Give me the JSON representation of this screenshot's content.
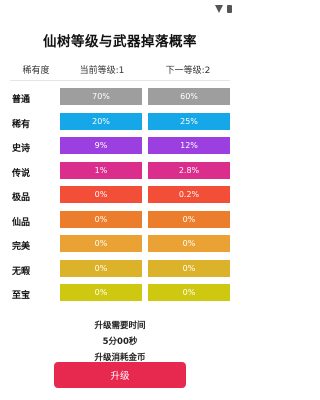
{
  "status_bar": {
    "time": "",
    "icons": [
      "wifi-icon",
      "battery-icon"
    ]
  },
  "title": "仙树等级与武器掉落概率",
  "table": {
    "headers": [
      "稀有度",
      "当前等级:1",
      "下一等级:2"
    ],
    "rows": [
      {
        "name": "普通",
        "current": "70%",
        "next": "60%",
        "color": "#9e9e9e"
      },
      {
        "name": "稀有",
        "current": "20%",
        "next": "25%",
        "color": "#16a7e8"
      },
      {
        "name": "史诗",
        "current": "9%",
        "next": "12%",
        "color": "#9c3fe0"
      },
      {
        "name": "传说",
        "current": "1%",
        "next": "2.8%",
        "color": "#db2e8c"
      },
      {
        "name": "极品",
        "current": "0%",
        "next": "0.2%",
        "color": "#f24e38"
      },
      {
        "name": "仙品",
        "current": "0%",
        "next": "0%",
        "color": "#ec7d2c"
      },
      {
        "name": "完美",
        "current": "0%",
        "next": "0%",
        "color": "#e9a233"
      },
      {
        "name": "无暇",
        "current": "0%",
        "next": "0%",
        "color": "#dcb22a"
      },
      {
        "name": "至宝",
        "current": "0%",
        "next": "0%",
        "color": "#cfc810"
      }
    ]
  },
  "upgrade_info": {
    "time_label": "升级需要时间",
    "time_value": "5分00秒",
    "cost_label": "升级消耗金币"
  },
  "upgrade_button": {
    "label": "升级",
    "color": "#e8294f"
  }
}
